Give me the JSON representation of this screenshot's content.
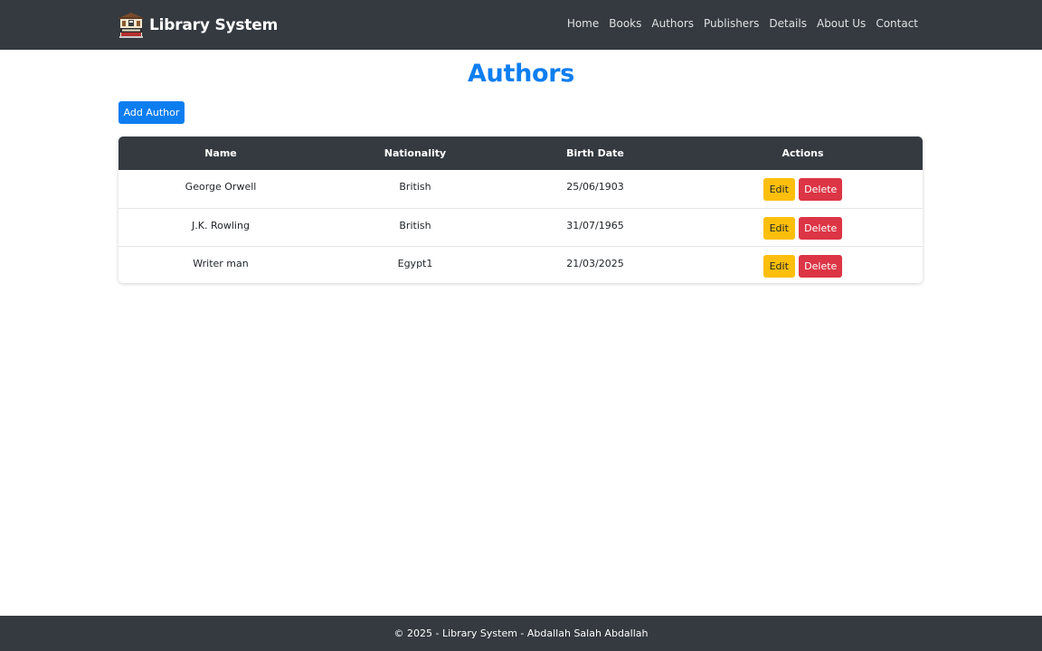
{
  "navbar": {
    "brand": "Library System",
    "logo_icon": "library-building-icon",
    "links": [
      "Home",
      "Books",
      "Authors",
      "Publishers",
      "Details",
      "About Us",
      "Contact"
    ]
  },
  "page": {
    "title": "Authors",
    "add_button": "Add Author"
  },
  "table": {
    "headers": [
      "Name",
      "Nationality",
      "Birth Date",
      "Actions"
    ],
    "rows": [
      {
        "name": "George Orwell",
        "nationality": "British",
        "birth_date": "25/06/1903",
        "edit": "Edit",
        "delete": "Delete"
      },
      {
        "name": "J.K. Rowling",
        "nationality": "British",
        "birth_date": "31/07/1965",
        "edit": "Edit",
        "delete": "Delete"
      },
      {
        "name": "Writer man",
        "nationality": "Egypt1",
        "birth_date": "21/03/2025",
        "edit": "Edit",
        "delete": "Delete"
      }
    ]
  },
  "footer": {
    "text": "© 2025 - Library System - Abdallah Salah Abdallah"
  },
  "colors": {
    "navbar": "#343a40",
    "primary": "#0d7ef0",
    "warning": "#fdbf0c",
    "danger": "#dc3545"
  }
}
